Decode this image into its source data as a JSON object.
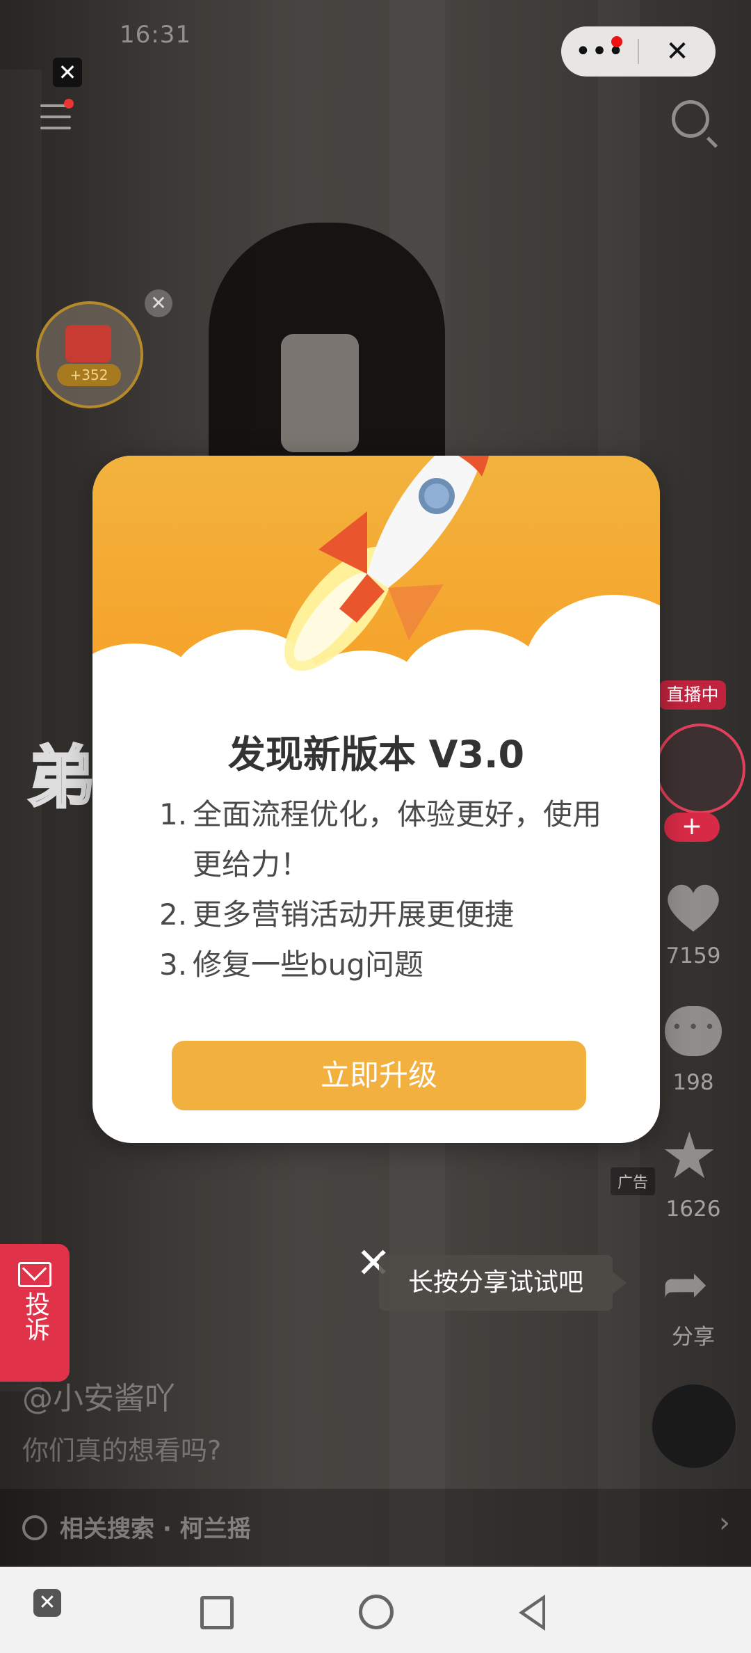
{
  "status_bar": {
    "time": "16:31"
  },
  "top_pill": {
    "more_label": "•••",
    "close_label": "✕"
  },
  "ad_close": "✕",
  "red_packet": {
    "amount": "+352",
    "close": "✕"
  },
  "overlay_text": "弟",
  "right_rail": {
    "live_badge": "直播中",
    "follow_plus": "+",
    "likes": "7159",
    "comments": "198",
    "favorites": "1626",
    "share_label": "分享",
    "ad_badge": "广告"
  },
  "report_button": {
    "label": "投诉"
  },
  "share_tip": {
    "close": "✕",
    "text": "长按分享试试吧"
  },
  "post": {
    "username": "@小安酱吖",
    "caption": "你们真的想看吗?",
    "related_search": "相关搜索 · 柯兰摇",
    "chevron": "›"
  },
  "update_dialog": {
    "title": "发现新版本 V3.0",
    "items": [
      {
        "num": "1.",
        "text": "全面流程优化，体验更好，使用更给力！"
      },
      {
        "num": "2.",
        "text": "更多营销活动开展更便捷"
      },
      {
        "num": "3.",
        "text": "修复一些bug问题"
      }
    ],
    "button_label": "立即升级",
    "accent_color": "#f2b03f"
  },
  "nav_bar": {
    "close": "✕"
  }
}
